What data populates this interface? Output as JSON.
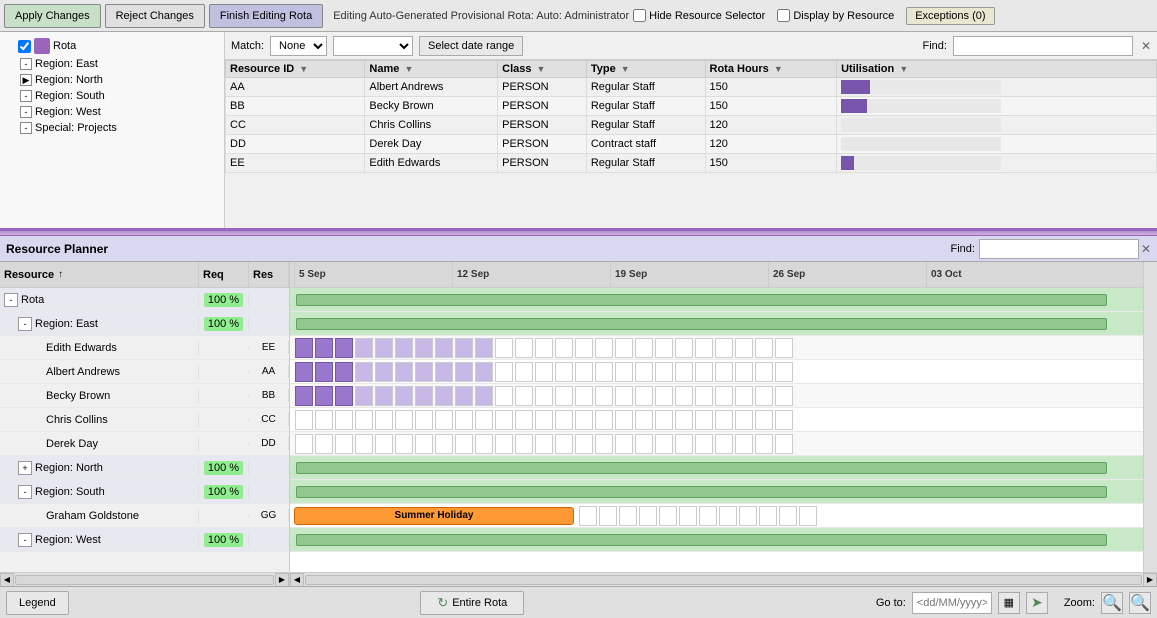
{
  "toolbar": {
    "apply_label": "Apply Changes",
    "reject_label": "Reject Changes",
    "finish_label": "Finish Editing Rota",
    "editing_text": "Editing Auto-Generated Provisional Rota: Auto: Administrator",
    "hide_resource_label": "Hide Resource Selector",
    "display_by_resource_label": "Display by Resource",
    "exceptions_label": "Exceptions (0)"
  },
  "match_bar": {
    "label": "Match:",
    "none_option": "None",
    "find_label": "Find:",
    "date_range_btn": "Select date range",
    "find_x": "✕"
  },
  "table": {
    "headers": [
      "Resource ID",
      "Name",
      "Class",
      "Type",
      "Rota Hours",
      "Utilisation"
    ],
    "rows": [
      {
        "resource_id": "AA",
        "name": "Albert Andrews",
        "class": "PERSON",
        "type": "Regular Staff",
        "rota_hours": "150",
        "util_pct": 18
      },
      {
        "resource_id": "BB",
        "name": "Becky Brown",
        "class": "PERSON",
        "type": "Regular Staff",
        "rota_hours": "150",
        "util_pct": 16
      },
      {
        "resource_id": "CC",
        "name": "Chris Collins",
        "class": "PERSON",
        "type": "Regular Staff",
        "rota_hours": "120",
        "util_pct": 0
      },
      {
        "resource_id": "DD",
        "name": "Derek Day",
        "class": "PERSON",
        "type": "Contract staff",
        "rota_hours": "120",
        "util_pct": 0
      },
      {
        "resource_id": "EE",
        "name": "Edith Edwards",
        "class": "PERSON",
        "type": "Regular Staff",
        "rota_hours": "150",
        "util_pct": 8
      }
    ]
  },
  "tree": {
    "root_label": "Rota",
    "items": [
      {
        "label": "Region: East",
        "indent": 1,
        "toggle": "-"
      },
      {
        "label": "Region: North",
        "indent": 1,
        "toggle": "▶"
      },
      {
        "label": "Region: South",
        "indent": 1,
        "toggle": "-"
      },
      {
        "label": "Region: West",
        "indent": 1,
        "toggle": "-"
      },
      {
        "label": "Special: Projects",
        "indent": 1,
        "toggle": "-"
      }
    ]
  },
  "planner": {
    "title": "Resource Planner",
    "find_label": "Find:",
    "find_x": "✕",
    "col_resource": "Resource",
    "col_req": "Req",
    "col_res": "Res",
    "weeks": [
      "5 Sep",
      "12 Sep",
      "19 Sep",
      "26 Sep",
      "03 Oct"
    ],
    "rows": [
      {
        "name": "Rota",
        "indent": 0,
        "toggle": "-",
        "req": "100 %",
        "res": "",
        "type": "group"
      },
      {
        "name": "Region: East",
        "indent": 1,
        "toggle": "-",
        "req": "100 %",
        "res": "",
        "type": "group"
      },
      {
        "name": "Edith Edwards",
        "indent": 2,
        "toggle": null,
        "req": "",
        "res": "EE",
        "type": "person"
      },
      {
        "name": "Albert Andrews",
        "indent": 2,
        "toggle": null,
        "req": "",
        "res": "AA",
        "type": "person"
      },
      {
        "name": "Becky Brown",
        "indent": 2,
        "toggle": null,
        "req": "",
        "res": "BB",
        "type": "person"
      },
      {
        "name": "Chris Collins",
        "indent": 2,
        "toggle": null,
        "req": "",
        "res": "CC",
        "type": "person"
      },
      {
        "name": "Derek Day",
        "indent": 2,
        "toggle": null,
        "req": "",
        "res": "DD",
        "type": "person"
      },
      {
        "name": "Region: North",
        "indent": 1,
        "toggle": "+",
        "req": "100 %",
        "res": "",
        "type": "group"
      },
      {
        "name": "Region: South",
        "indent": 1,
        "toggle": "-",
        "req": "100 %",
        "res": "",
        "type": "group"
      },
      {
        "name": "Graham Goldstone",
        "indent": 2,
        "toggle": null,
        "req": "",
        "res": "GG",
        "type": "person",
        "special": "holiday"
      },
      {
        "name": "Region: West",
        "indent": 1,
        "toggle": "-",
        "req": "100 %",
        "res": "",
        "type": "group"
      }
    ]
  },
  "bottom": {
    "legend_label": "Legend",
    "entire_rota_label": "Entire Rota",
    "goto_label": "Go to:",
    "goto_placeholder": "<dd/MM/yyyy>",
    "zoom_label": "Zoom:",
    "calendar_icon": "▦",
    "arrow_icon": "➤"
  }
}
